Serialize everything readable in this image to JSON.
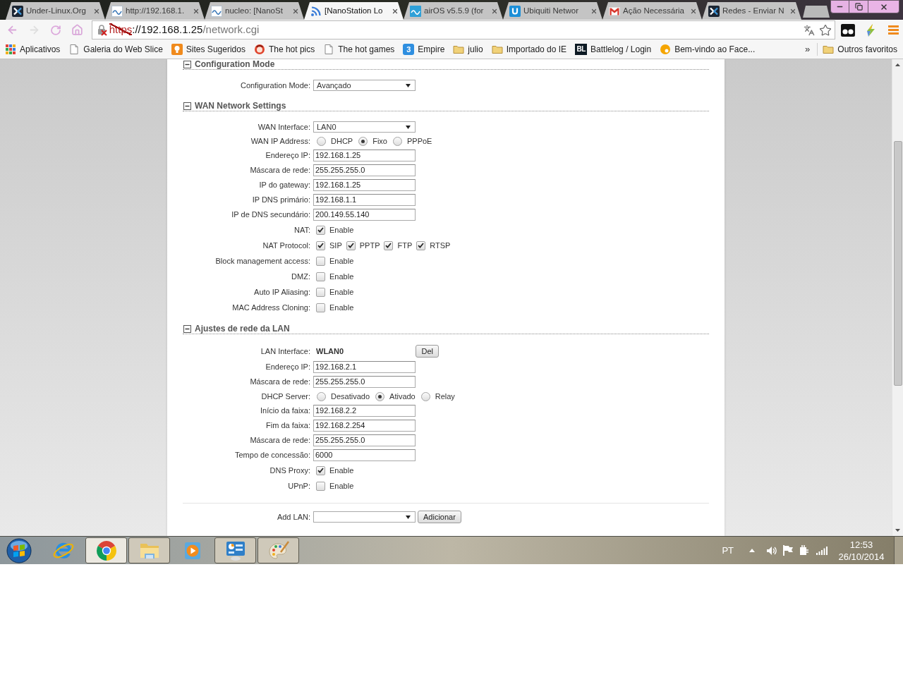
{
  "tabs": [
    {
      "title": "Under-Linux.Org",
      "kind": "chevron",
      "selected": false
    },
    {
      "title": "http://192.168.1.",
      "kind": "wave",
      "selected": false
    },
    {
      "title": "nucleo: [NanoSt",
      "kind": "wave",
      "selected": false
    },
    {
      "title": "[NanoStation Lo",
      "kind": "signal",
      "selected": true
    },
    {
      "title": "airOS v5.5.9 (for",
      "kind": "bluewave",
      "selected": false
    },
    {
      "title": "Ubiquiti Networ",
      "kind": "utile",
      "selected": false
    },
    {
      "title": "Ação Necessária",
      "kind": "mail",
      "selected": false
    },
    {
      "title": "Redes - Enviar N",
      "kind": "chevron",
      "selected": false
    }
  ],
  "navigation": {
    "back_disabled": false,
    "forward_disabled": true
  },
  "address_bar": {
    "secure": false,
    "scheme": "https",
    "host": "://192.168.1.25",
    "path": "/network.cgi"
  },
  "bookmarks": {
    "items": [
      {
        "label": "Aplicativos",
        "kind": "apps"
      },
      {
        "label": "Galeria do Web Slice",
        "kind": "page"
      },
      {
        "label": "Sites Sugeridos",
        "kind": "bulb"
      },
      {
        "label": "The hot pics",
        "kind": "face"
      },
      {
        "label": "The hot games",
        "kind": "page"
      },
      {
        "label": "Empire",
        "kind": "bluetile",
        "icon_text": "3"
      },
      {
        "label": "julio",
        "kind": "folder"
      },
      {
        "label": "Importado do IE",
        "kind": "folder"
      },
      {
        "label": "Battlelog / Login",
        "kind": "darktile",
        "icon_text": "BL"
      },
      {
        "label": "Bem-vindo ao Face...",
        "kind": "dot"
      }
    ],
    "overflow": "»",
    "other": {
      "label": "Outros favoritos",
      "kind": "folder"
    }
  },
  "sections": [
    {
      "title": "Configuration Mode",
      "expanded": true,
      "rows": [
        {
          "kind": "select",
          "label": "Configuration Mode:",
          "value": "Avançado"
        }
      ]
    },
    {
      "title": "WAN Network Settings",
      "expanded": true,
      "rows": [
        {
          "kind": "select",
          "label": "WAN Interface:",
          "value": "LAN0"
        },
        {
          "kind": "radio",
          "label": "WAN IP Address:",
          "options": [
            {
              "label": "DHCP",
              "selected": false
            },
            {
              "label": "Fixo",
              "selected": true
            },
            {
              "label": "PPPoE",
              "selected": false
            }
          ]
        },
        {
          "kind": "text",
          "label": "Endereço IP:",
          "value": "192.168.1.25"
        },
        {
          "kind": "text",
          "label": "Máscara de rede:",
          "value": "255.255.255.0"
        },
        {
          "kind": "text",
          "label": "IP do gateway:",
          "value": "192.168.1.25"
        },
        {
          "kind": "text",
          "label": "IP DNS primário:",
          "value": "192.168.1.1"
        },
        {
          "kind": "text",
          "label": "IP de DNS secundário:",
          "value": "200.149.55.140"
        },
        {
          "kind": "checkbox",
          "label": "NAT:",
          "options": [
            {
              "label": "Enable",
              "checked": true
            }
          ]
        },
        {
          "kind": "checkbox",
          "label": "NAT Protocol:",
          "options": [
            {
              "label": "SIP",
              "checked": true
            },
            {
              "label": "PPTP",
              "checked": true
            },
            {
              "label": "FTP",
              "checked": true
            },
            {
              "label": "RTSP",
              "checked": true
            }
          ]
        },
        {
          "kind": "checkbox",
          "label": "Block management access:",
          "options": [
            {
              "label": "Enable",
              "checked": false
            }
          ]
        },
        {
          "kind": "checkbox",
          "label": "DMZ:",
          "options": [
            {
              "label": "Enable",
              "checked": false
            }
          ]
        },
        {
          "kind": "checkbox",
          "label": "Auto IP Aliasing:",
          "options": [
            {
              "label": "Enable",
              "checked": false
            }
          ]
        },
        {
          "kind": "checkbox",
          "label": "MAC Address Cloning:",
          "options": [
            {
              "label": "Enable",
              "checked": false
            }
          ]
        }
      ]
    },
    {
      "title": "Ajustes de rede da LAN",
      "expanded": true,
      "rows": [
        {
          "kind": "static",
          "label": "LAN Interface:",
          "value": "WLAN0",
          "button": "Del"
        },
        {
          "kind": "text",
          "label": "Endereço IP:",
          "value": "192.168.2.1"
        },
        {
          "kind": "text",
          "label": "Máscara de rede:",
          "value": "255.255.255.0"
        },
        {
          "kind": "radio",
          "label": "DHCP Server:",
          "options": [
            {
              "label": "Desativado",
              "selected": false
            },
            {
              "label": "Ativado",
              "selected": true
            },
            {
              "label": "Relay",
              "selected": false
            }
          ]
        },
        {
          "kind": "text",
          "label": "Início da faixa:",
          "value": "192.168.2.2"
        },
        {
          "kind": "text",
          "label": "Fim da faixa:",
          "value": "192.168.2.254"
        },
        {
          "kind": "text",
          "label": "Máscara de rede:",
          "value": "255.255.255.0"
        },
        {
          "kind": "text",
          "label": "Tempo de concessão:",
          "value": "6000"
        },
        {
          "kind": "checkbox",
          "label": "DNS Proxy:",
          "options": [
            {
              "label": "Enable",
              "checked": true
            }
          ]
        },
        {
          "kind": "checkbox",
          "label": "UPnP:",
          "options": [
            {
              "label": "Enable",
              "checked": false
            }
          ]
        }
      ]
    }
  ],
  "add_lan": {
    "label": "Add LAN:",
    "button": "Adicionar"
  },
  "taskbar": {
    "apps": [
      {
        "kind": "ie",
        "running": false,
        "selected": false
      },
      {
        "kind": "chrome",
        "running": true,
        "selected": true
      },
      {
        "kind": "explorer",
        "running": true,
        "selected": false
      },
      {
        "kind": "media",
        "running": false,
        "selected": false
      },
      {
        "kind": "control",
        "running": true,
        "selected": false
      },
      {
        "kind": "paint",
        "running": true,
        "selected": false
      }
    ],
    "language": "PT",
    "time": "12:53",
    "date": "26/10/2014"
  }
}
